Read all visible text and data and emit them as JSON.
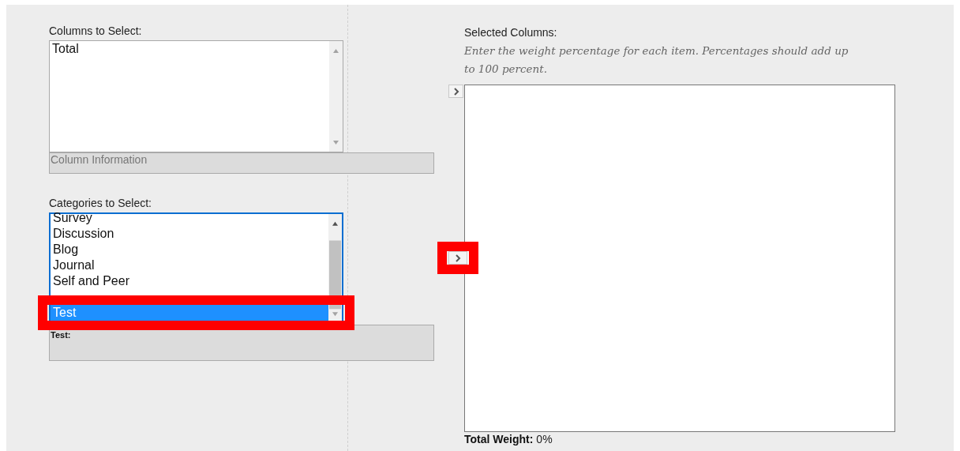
{
  "columns_to_select": {
    "label": "Columns to Select:",
    "items": [
      {
        "text": "Total",
        "selected": false,
        "highlighted": false
      }
    ],
    "info_label": "Column Information"
  },
  "categories_to_select": {
    "label": "Categories to Select:",
    "items": [
      {
        "text": "Survey",
        "selected": false,
        "highlighted": false
      },
      {
        "text": "Discussion",
        "selected": false,
        "highlighted": false
      },
      {
        "text": "Blog",
        "selected": false,
        "highlighted": false
      },
      {
        "text": "Journal",
        "selected": false,
        "highlighted": false
      },
      {
        "text": "Self and Peer",
        "selected": false,
        "highlighted": false
      },
      {
        "text": "Test",
        "selected": true,
        "highlighted": true
      }
    ],
    "info_detail": "Test:"
  },
  "selected_columns": {
    "label": "Selected Columns:",
    "instructions": "Enter the weight percentage for each item. Percentages should add up to 100 percent.",
    "move_buttons": [
      {
        "kind": "move",
        "highlighted": false
      },
      {
        "kind": "move",
        "highlighted": true
      }
    ],
    "total_weight_label": "Total Weight:",
    "total_weight_value": "0%"
  }
}
